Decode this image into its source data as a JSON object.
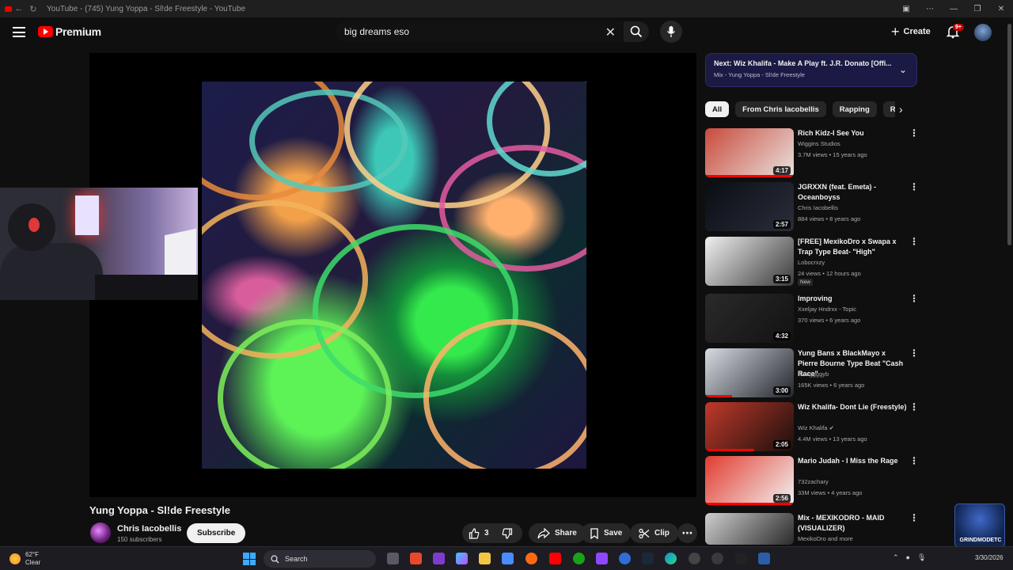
{
  "window": {
    "title": "YouTube - (745) Yung Yoppa - Sl!de Freestyle - YouTube"
  },
  "masthead": {
    "logo_text": "Premium",
    "search_value": "big dreams eso",
    "create_label": "Create",
    "notification_count": "9+"
  },
  "video": {
    "title": "Yung Yoppa - Sl!de Freestyle",
    "channel": "Chris Iacobellis",
    "subscribers": "150 subscribers",
    "subscribe_label": "Subscribe",
    "likes": "3",
    "share_label": "Share",
    "save_label": "Save",
    "clip_label": "Clip"
  },
  "next_up": {
    "title": "Next: Wiz Khalifa - Make A Play ft. J.R. Donato [Offi...",
    "subtitle": "Mix - Yung Yoppa - Sl!de Freestyle"
  },
  "chips": [
    "All",
    "From Chris Iacobellis",
    "Rapping",
    "Relate"
  ],
  "recommendations": [
    {
      "title": "Rich Kidz-I See You",
      "channel": "Wiggins Studios",
      "meta": "3.7M views • 15 years ago",
      "duration": "4:17",
      "progress": 1.0,
      "color1": "#c94a3b",
      "color2": "#e9e2df"
    },
    {
      "title": "JGRXXN (feat. Emeta) - Oceanboyss",
      "channel": "Chris Iacobellis",
      "meta": "884 views • 8 years ago",
      "duration": "2:57",
      "progress": 0,
      "color1": "#0b0d14",
      "color2": "#2a2e3a"
    },
    {
      "title": "[FREE] MexikoDro x Swapa x Trap Type Beat- \"High\"",
      "channel": "Lobocrxzy",
      "meta": "24 views • 12 hours ago",
      "duration": "3:15",
      "progress": 0,
      "badge": "New",
      "color1": "#f0f0f0",
      "color2": "#3a3a3a"
    },
    {
      "title": "Improving",
      "channel": "Xxeljay Hndrxx - Topic",
      "meta": "370 views • 6 years ago",
      "duration": "4:32",
      "progress": 0,
      "color1": "#2a2a2a",
      "color2": "#121212"
    },
    {
      "title": "Yung Bans x BlackMayo x Pierre Bourne Type Beat \"Cash Race\"",
      "channel": "Swaggggyb",
      "meta": "165K views • 6 years ago",
      "duration": "3:00",
      "progress": 0.3,
      "color1": "#d7dbe2",
      "color2": "#22252c"
    },
    {
      "title": "Wiz Khalifa- Dont Lie (Freestyle)",
      "channel": "Wiz Khalifa",
      "meta": "4.4M views • 13 years ago",
      "duration": "2:05",
      "progress": 0.55,
      "verified": true,
      "color1": "#c0392b",
      "color2": "#1a0f0c"
    },
    {
      "title": "Mario Judah - I Miss the Rage",
      "channel": "732zachary",
      "meta": "33M views • 4 years ago",
      "duration": "2:56",
      "progress": 1.0,
      "color1": "#e23b2e",
      "color2": "#f2f2f2"
    },
    {
      "title": "Mix - MEXIKODRO - MAID (VISUALIZER)",
      "channel": "MexikoDro and more",
      "meta": "",
      "duration": "",
      "progress": 0,
      "color1": "#cfcfcf",
      "color2": "#2a2a2a"
    }
  ],
  "taskbar": {
    "temperature": "62°F",
    "condition": "Clear",
    "search_label": "Search",
    "date": "3/30/2026"
  },
  "overlay": {
    "brand_text": "GRINDMODETC"
  }
}
